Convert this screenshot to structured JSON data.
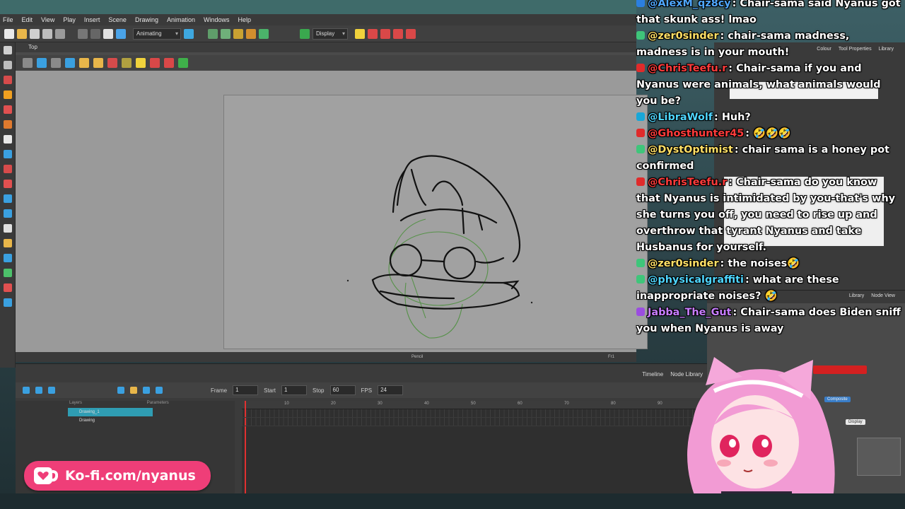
{
  "app": {
    "menu": [
      "File",
      "Edit",
      "View",
      "Play",
      "Insert",
      "Scene",
      "Drawing",
      "Animation",
      "Windows",
      "Help"
    ],
    "toolbar": {
      "workspace_select": "Animating",
      "display_select": "Display"
    },
    "view": {
      "tab_label": "Top",
      "status_tool": "Pencil",
      "status_frame": "Fr1"
    },
    "timeline": {
      "tabs": [
        "Timeline",
        "Node Library"
      ],
      "frame_label": "Frame",
      "frame_value": "1",
      "start_label": "Start",
      "start_value": "1",
      "stop_label": "Stop",
      "stop_value": "60",
      "fps_label": "FPS",
      "fps_value": "24",
      "layers_header": "Layers",
      "params_header": "Parameters",
      "layers": [
        "Drawing_1",
        "Drawing"
      ],
      "ruler_ticks": [
        "10",
        "20",
        "30",
        "40",
        "50",
        "60",
        "70",
        "80",
        "90"
      ]
    },
    "right_panel": {
      "tabs": [
        "Colour",
        "Tool Properties",
        "Library"
      ]
    },
    "node_view": {
      "tabs": [
        "Library",
        "Node View"
      ],
      "nodes": [
        "Composite",
        "Display"
      ]
    }
  },
  "chat": [
    {
      "user": "@AlexM_qz8cy",
      "text": "Chair-sama said Nyanus got that skunk ass! lmao",
      "color": "#4fa7ff",
      "badge": "#2b7fe0"
    },
    {
      "user": "@zer0sinder",
      "text": "chair-sama madness, madness is in your mouth!",
      "color": "#ffe066",
      "badge": "#3fc57a"
    },
    {
      "user": "@ChrisTeefu.r",
      "text": "Chair-sama if you and Nyanus were animals, what animals would you be?",
      "color": "#ff3b3b",
      "badge": "#e02b2b"
    },
    {
      "user": "@LibraWolf",
      "text": "Huh?",
      "color": "#4fd6ff",
      "badge": "#19a7d8"
    },
    {
      "user": "@Ghosthunter45",
      "text": "🤣🤣🤣",
      "color": "#ff3b3b",
      "badge": "#e02b2b"
    },
    {
      "user": "@DystOptimist",
      "text": "chair sama is a honey pot confirmed",
      "color": "#ffe066",
      "badge": "#3fc57a"
    },
    {
      "user": "@ChrisTeefu.r",
      "text": "Chair-sama do you know that Nyanus is intimidated by you-that's why she turns you off, you need to rise up and overthrow that tyrant Nyanus and take Husbanus for yourself.",
      "color": "#ff3b3b",
      "badge": "#e02b2b"
    },
    {
      "user": "@zer0sinder",
      "text": "the noises🤣",
      "color": "#ffe066",
      "badge": "#3fc57a"
    },
    {
      "user": "@physicalgraffiti",
      "text": "what are these inappropriate noises? 🤣",
      "color": "#4fd6ff",
      "badge": "#3fc57a"
    },
    {
      "user": "Jabba_The_Gut",
      "text": "Chair-sama does Biden sniff you when Nyanus is away",
      "color": "#c77dff",
      "badge": "#9b4de0"
    }
  ],
  "kofi": {
    "text": "Ko-fi.com/nyanus"
  }
}
